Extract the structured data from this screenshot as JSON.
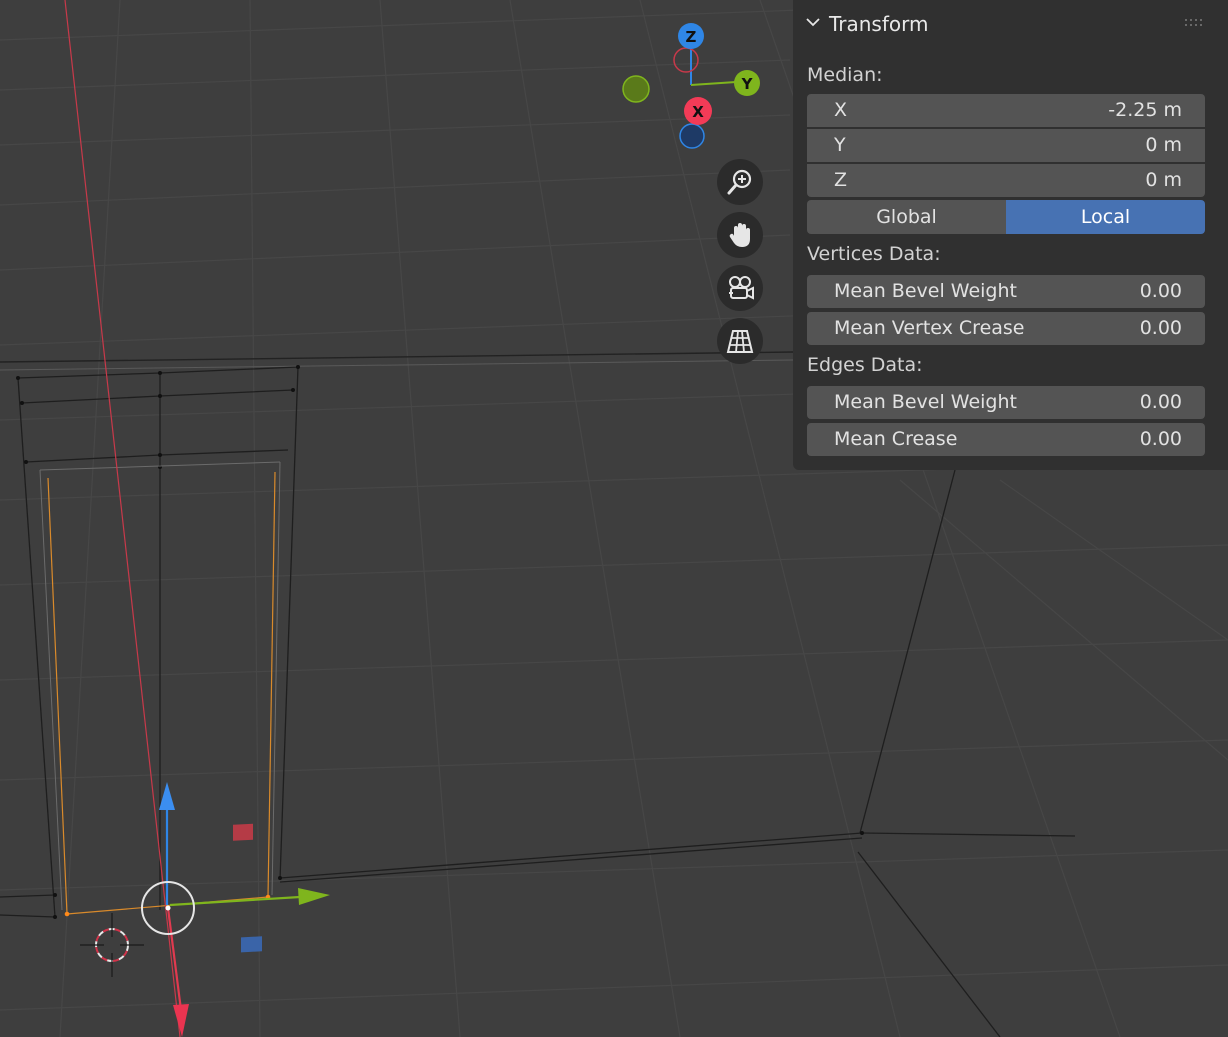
{
  "viewport": {
    "gizmo": {
      "axes": [
        {
          "label": "Z",
          "color": "#2f86e6"
        },
        {
          "label": "Y",
          "color": "#7fb51d"
        },
        {
          "label": "X",
          "color": "#f33b57"
        }
      ]
    },
    "nav_icons": [
      "zoom-icon",
      "hand-pan-icon",
      "camera-view-icon",
      "ortho-grid-icon"
    ]
  },
  "panel": {
    "title": "Transform",
    "median_label": "Median:",
    "median": {
      "x": {
        "label": "X",
        "value": "-2.25 m"
      },
      "y": {
        "label": "Y",
        "value": "0 m"
      },
      "z": {
        "label": "Z",
        "value": "0 m"
      }
    },
    "space": {
      "global": "Global",
      "local": "Local",
      "active": "Local"
    },
    "vertices_label": "Vertices Data:",
    "vertices": [
      {
        "label": "Mean Bevel Weight",
        "value": "0.00"
      },
      {
        "label": "Mean Vertex Crease",
        "value": "0.00"
      }
    ],
    "edges_label": "Edges Data:",
    "edges": [
      {
        "label": "Mean Bevel Weight",
        "value": "0.00"
      },
      {
        "label": "Mean Crease",
        "value": "0.00"
      }
    ]
  },
  "colors": {
    "accent": "#4772b3",
    "x_axis": "#f33b57",
    "y_axis": "#7fb51d",
    "z_axis": "#2f86e6",
    "panel_bg": "#303030",
    "field_bg": "#545454"
  }
}
